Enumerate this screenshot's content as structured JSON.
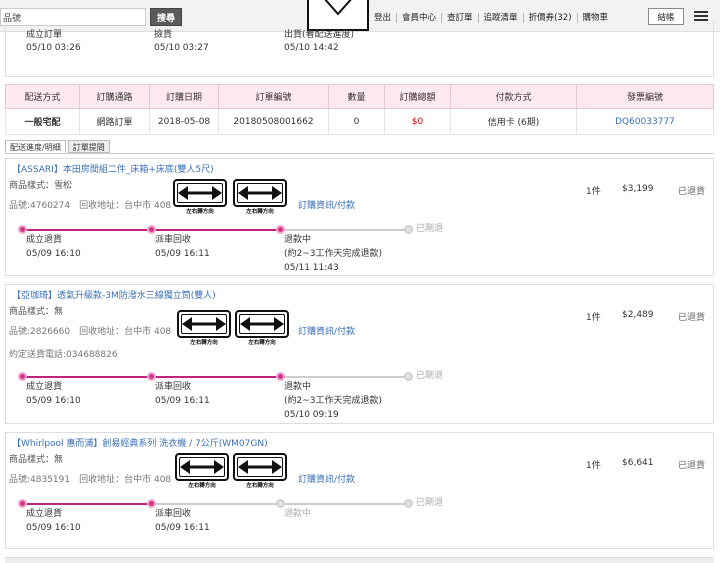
{
  "header": {
    "search_value": "品號",
    "search_button": "搜尋",
    "nav": [
      "登出",
      "會員中心",
      "查訂單",
      "追蹤清單",
      "折價券(32)",
      "購物車"
    ],
    "checkout_button": "結帳"
  },
  "top_status": {
    "col1_label": "成立訂單",
    "col1_date": "05/10 03:26",
    "col2_label": "撿貨",
    "col2_date": "05/10 03:27",
    "col3_label": "出貨(看配送進度)",
    "col3_date": "05/10 14:42"
  },
  "summary": {
    "headers": [
      "配送方式",
      "訂購通路",
      "訂購日期",
      "訂單編號",
      "數量",
      "訂購總額",
      "付款方式",
      "發票編號"
    ],
    "row": {
      "delivery": "一般宅配",
      "channel": "網路訂單",
      "date": "2018-05-08",
      "order_no": "20180508001662",
      "qty": "0",
      "total": "$0",
      "payment": "信用卡 (6期)",
      "invoice": "DQ60033777"
    }
  },
  "tabs": [
    "配送進度/明細",
    "訂單提問"
  ],
  "sign_caption": "左右轉方向",
  "items": [
    {
      "title": "【ASSARI】本田房間組二件_床箱+床底(雙人5尺)",
      "style": "商品樣式：雪松",
      "product_info": "品號:4760274　回收地址：台中市 408",
      "phone": "",
      "link": "訂購資訊/付款",
      "qty": "1件",
      "price": "$3,199",
      "status": "已退貨",
      "steps": [
        {
          "label": "成立退貨",
          "date": "05/09 16:10",
          "extra": ""
        },
        {
          "label": "派車回收",
          "date": "05/09 16:11",
          "extra": ""
        },
        {
          "label": "退款中",
          "date": "(約2~3工作天完成退款)",
          "extra": "05/11 11:43"
        },
        {
          "label": "已剛退",
          "date": "",
          "extra": ""
        }
      ]
    },
    {
      "title": "【亞珈琦】透氣升級款-3M防潑水三線獨立筒(雙人)",
      "style": "商品樣式：無",
      "product_info": "品號:2826660　回收地址：台中市 408",
      "phone": "約定送貨電話:034688826",
      "link": "訂購資訊/付款",
      "qty": "1件",
      "price": "$2,489",
      "status": "已退貨",
      "steps": [
        {
          "label": "成立退貨",
          "date": "05/09 16:10",
          "extra": ""
        },
        {
          "label": "派車回收",
          "date": "05/09 16:11",
          "extra": ""
        },
        {
          "label": "退款中",
          "date": "(約2~3工作天完成退款)",
          "extra": "05/10 09:19"
        },
        {
          "label": "已剛退",
          "date": "",
          "extra": ""
        }
      ]
    },
    {
      "title": "【Whirlpool 惠而浦】創易經典系列 洗衣機 / 7公斤(WM07GN)",
      "style": "商品樣式：無",
      "product_info": "品號:4835191　回收地址：台中市 408",
      "phone": "",
      "link": "訂購資訊/付款",
      "qty": "1件",
      "price": "$6,641",
      "status": "已退貨",
      "steps": [
        {
          "label": "成立退貨",
          "date": "05/09 16:10",
          "extra": ""
        },
        {
          "label": "派車回收",
          "date": "05/09 16:11",
          "extra": ""
        },
        {
          "label": "退款中",
          "date": "",
          "extra": ""
        },
        {
          "label": "已剛退",
          "date": "",
          "extra": ""
        }
      ]
    }
  ]
}
